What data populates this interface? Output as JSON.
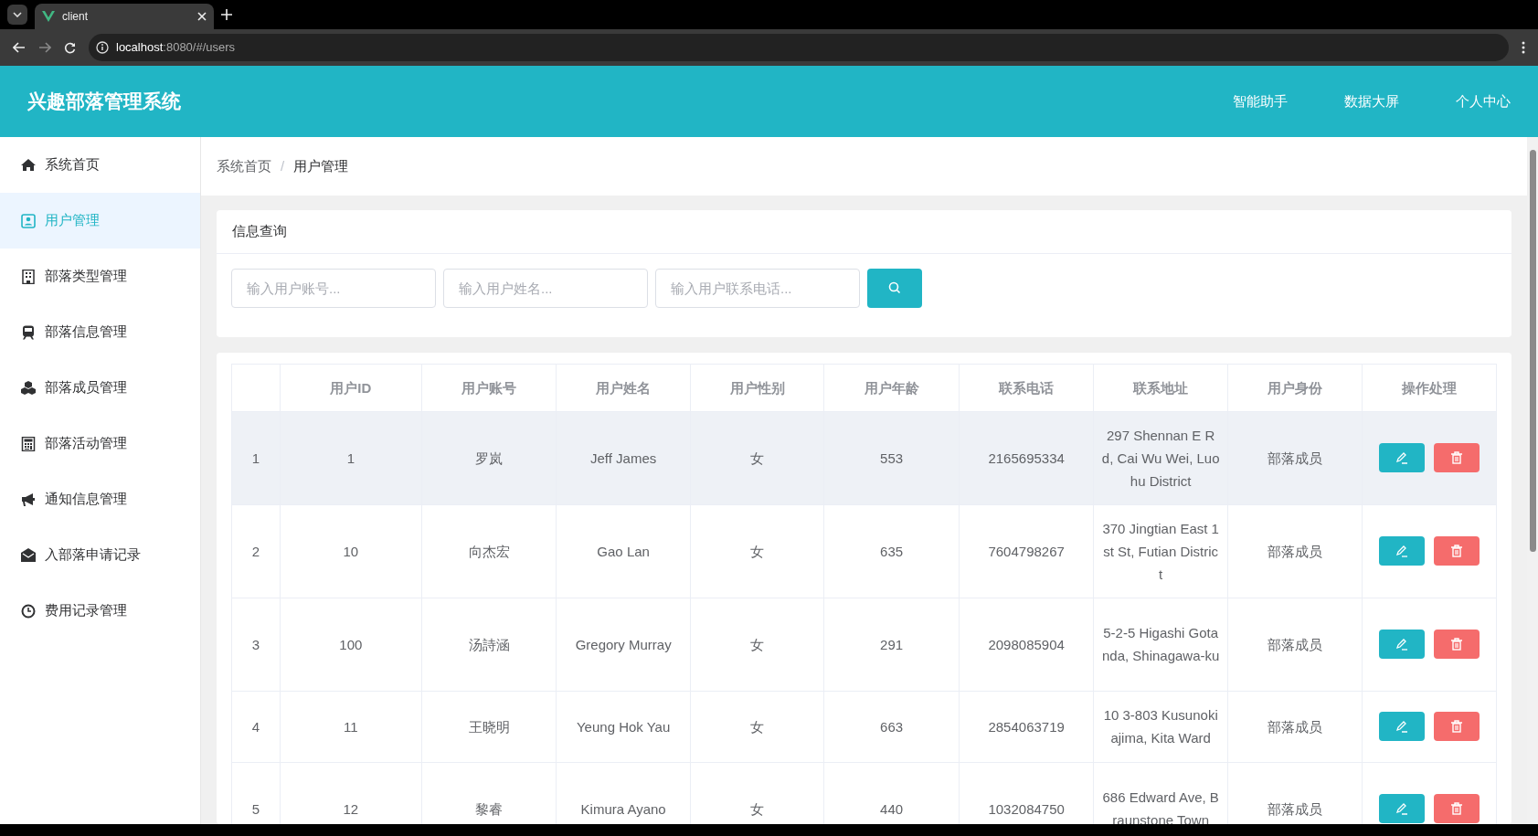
{
  "browser": {
    "tab_title": "client",
    "url_host": "localhost",
    "url_path": ":8080/#/users"
  },
  "header": {
    "title": "兴趣部落管理系统",
    "nav": [
      "智能助手",
      "数据大屏",
      "个人中心"
    ]
  },
  "sidebar": {
    "items": [
      {
        "label": "系统首页",
        "selected": false
      },
      {
        "label": "用户管理",
        "selected": true
      },
      {
        "label": "部落类型管理",
        "selected": false
      },
      {
        "label": "部落信息管理",
        "selected": false
      },
      {
        "label": "部落成员管理",
        "selected": false
      },
      {
        "label": "部落活动管理",
        "selected": false
      },
      {
        "label": "通知信息管理",
        "selected": false
      },
      {
        "label": "入部落申请记录",
        "selected": false
      },
      {
        "label": "费用记录管理",
        "selected": false
      }
    ]
  },
  "breadcrumb": [
    "系统首页",
    "用户管理"
  ],
  "breadcrumb_separator": "/",
  "search_panel": {
    "title": "信息查询",
    "fields": [
      {
        "placeholder": "输入用户账号..."
      },
      {
        "placeholder": "输入用户姓名..."
      },
      {
        "placeholder": "输入用户联系电话..."
      }
    ]
  },
  "table": {
    "columns": [
      "",
      "用户ID",
      "用户账号",
      "用户姓名",
      "用户性别",
      "用户年龄",
      "联系电话",
      "联系地址",
      "用户身份",
      "操作处理"
    ],
    "rows": [
      {
        "index": "1",
        "id": "1",
        "account": "罗岚",
        "name": "Jeff James",
        "gender": "女",
        "age": "553",
        "phone": "2165695334",
        "address": "297 Shennan E Rd, Cai Wu Wei, Luohu District",
        "role": "部落成员",
        "hovered": true
      },
      {
        "index": "2",
        "id": "10",
        "account": "向杰宏",
        "name": "Gao Lan",
        "gender": "女",
        "age": "635",
        "phone": "7604798267",
        "address": "370 Jingtian East 1st St, Futian District",
        "role": "部落成员",
        "hovered": false
      },
      {
        "index": "3",
        "id": "100",
        "account": "汤詩涵",
        "name": "Gregory Murray",
        "gender": "女",
        "age": "291",
        "phone": "2098085904",
        "address": "5-2-5 Higashi Gotanda, Shinagawa-ku",
        "role": "部落成员",
        "hovered": false
      },
      {
        "index": "4",
        "id": "11",
        "account": "王晓明",
        "name": "Yeung Hok Yau",
        "gender": "女",
        "age": "663",
        "phone": "2854063719",
        "address": "10 3-803 Kusunokiajima, Kita Ward",
        "role": "部落成员",
        "hovered": false
      },
      {
        "index": "5",
        "id": "12",
        "account": "黎睿",
        "name": "Kimura Ayano",
        "gender": "女",
        "age": "440",
        "phone": "1032084750",
        "address": "686 Edward Ave, Braunstone Town",
        "role": "部落成员",
        "hovered": false
      }
    ]
  }
}
